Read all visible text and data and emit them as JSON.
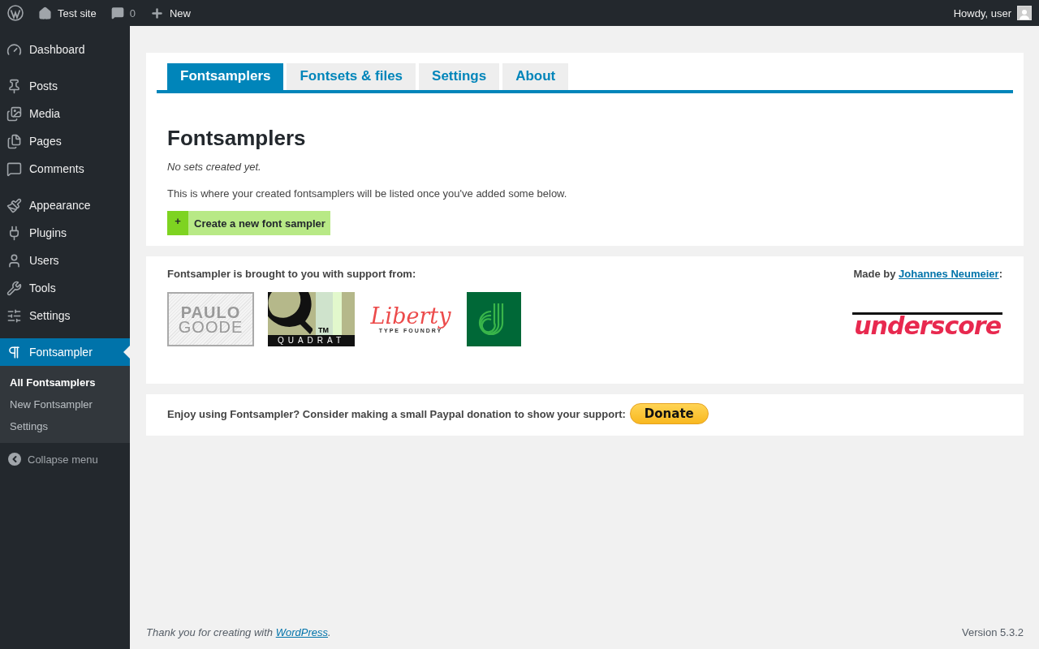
{
  "admin_bar": {
    "site_name": "Test site",
    "comments_count": "0",
    "new_label": "New",
    "greeting": "Howdy, user"
  },
  "sidebar": {
    "groups": [
      [
        {
          "label": "Dashboard",
          "selected": false
        }
      ],
      [
        {
          "label": "Posts",
          "selected": false
        },
        {
          "label": "Media",
          "selected": false
        },
        {
          "label": "Pages",
          "selected": false
        },
        {
          "label": "Comments",
          "selected": false
        }
      ],
      [
        {
          "label": "Appearance",
          "selected": false
        },
        {
          "label": "Plugins",
          "selected": false
        },
        {
          "label": "Users",
          "selected": false
        },
        {
          "label": "Tools",
          "selected": false
        },
        {
          "label": "Settings",
          "selected": false
        }
      ],
      [
        {
          "label": "Fontsampler",
          "selected": true
        }
      ]
    ],
    "submenu": [
      {
        "label": "All Fontsamplers",
        "selected": true
      },
      {
        "label": "New Fontsampler",
        "selected": false
      },
      {
        "label": "Settings",
        "selected": false
      }
    ],
    "collapse": "Collapse menu"
  },
  "tabs": [
    {
      "label": "Fontsamplers",
      "selected": true
    },
    {
      "label": "Fontsets & files",
      "selected": false
    },
    {
      "label": "Settings",
      "selected": false
    },
    {
      "label": "About",
      "selected": false
    }
  ],
  "main": {
    "heading": "Fontsamplers",
    "empty_note": "No sets created yet.",
    "description": "This is where your created fontsamplers will be listed once you've added some below.",
    "create_button": {
      "icon": "+",
      "label": "Create a new font sampler"
    }
  },
  "support": {
    "intro": "Fontsampler is brought to you with support from:",
    "made_by": {
      "prefix": "Made by ",
      "link": "Johannes Neumeier",
      "suffix": ":"
    },
    "sponsors": [
      {
        "kind": "paulo",
        "lines": [
          "PAULO",
          "GOODE"
        ]
      },
      {
        "kind": "quadrat",
        "text": "QUADRAT",
        "tm": "TM"
      },
      {
        "kind": "liberty",
        "title": "Liberty",
        "sub": "TYPE FOUNDRY"
      },
      {
        "kind": "d"
      }
    ],
    "author_logo": "underscore"
  },
  "donate": {
    "text": "Enjoy using Fontsampler? Consider making a small Paypal donation to show your support:",
    "button": "Donate"
  },
  "footer": {
    "prefix": "Thank you for creating with ",
    "link": "WordPress",
    "suffix": ".",
    "version": "Version 5.3.2"
  }
}
